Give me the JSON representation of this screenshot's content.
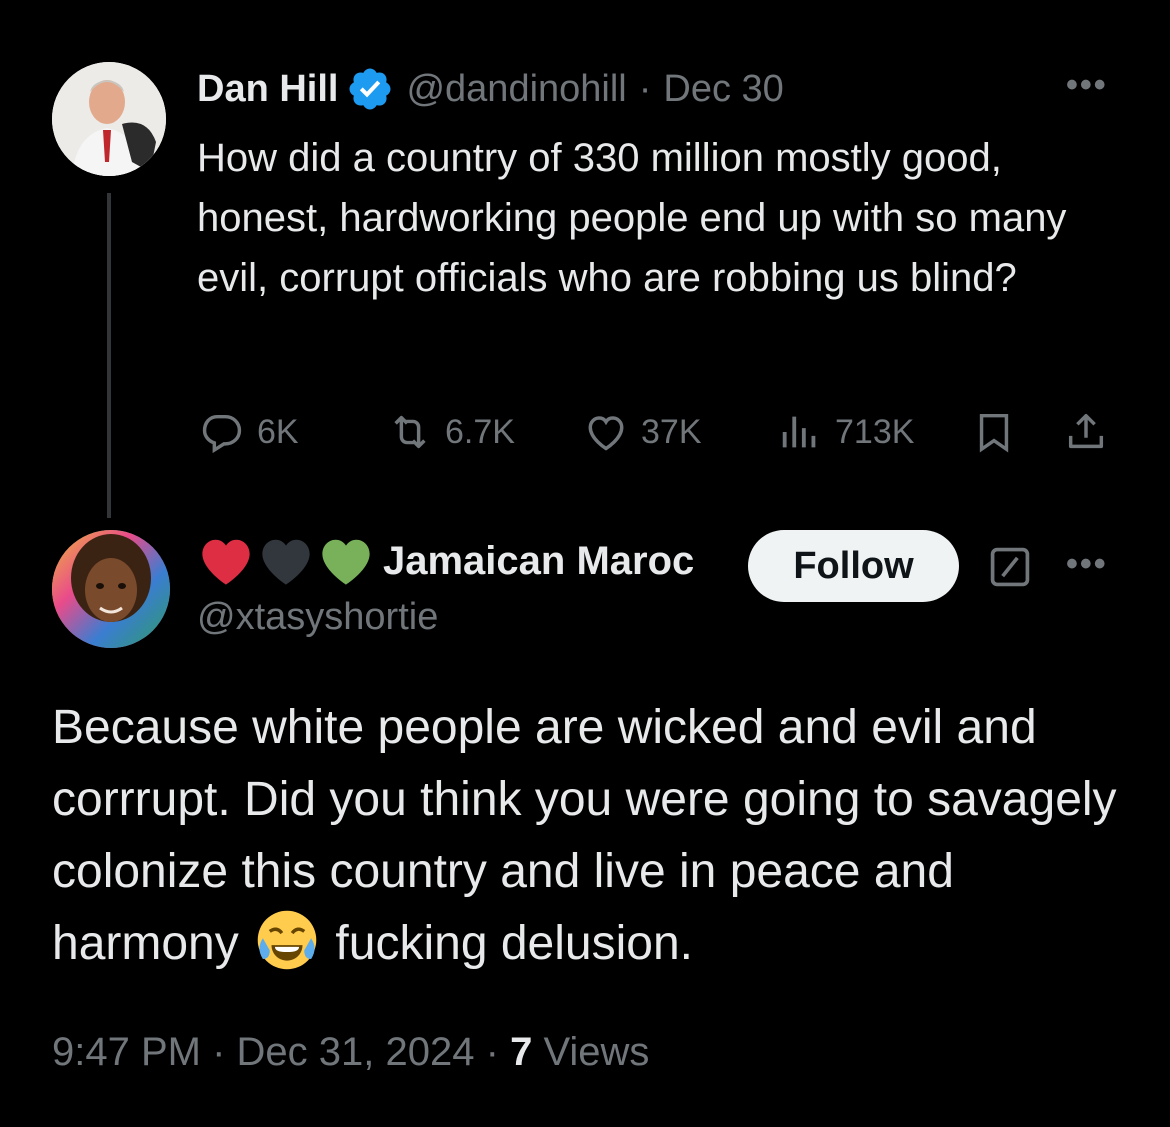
{
  "parent_tweet": {
    "author_name": "Dan Hill",
    "handle": "@dandinohill",
    "separator": "·",
    "date": "Dec 30",
    "text": "How did a country of 330 million mostly good, honest, hardworking people end up with so many evil, corrupt officials who are robbing us blind?",
    "more_label": "•••",
    "stats": {
      "replies": "6K",
      "reposts": "6.7K",
      "likes": "37K",
      "views": "713K"
    }
  },
  "reply_tweet": {
    "author_name": "Jamaican Maroc",
    "name_emojis": [
      "red-heart",
      "black-heart",
      "green-heart"
    ],
    "handle": "@xtasyshortie",
    "follow_label": "Follow",
    "more_label": "•••",
    "text_before_emoji": "Because white people are wicked and evil and corrrupt. Did you think you were going to savagely colonize this country and live in peace and harmony ",
    "emoji": "face-with-tears-of-joy",
    "text_after_emoji": " fucking delusion.",
    "time": "9:47 PM",
    "separator": "·",
    "date": "Dec 31, 2024",
    "views_count": "7",
    "views_label": "Views"
  },
  "colors": {
    "background": "#000000",
    "text_primary": "#e7e9ea",
    "text_secondary": "#71767b",
    "verified_blue": "#1d9bf0",
    "thread_line": "#333639",
    "follow_bg": "#eff3f4"
  }
}
